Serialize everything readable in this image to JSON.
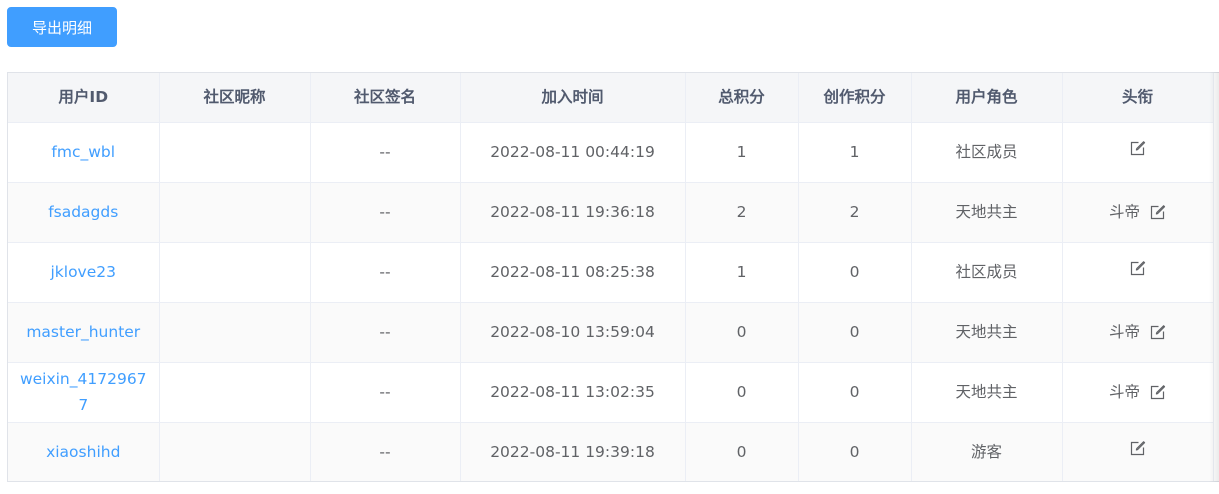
{
  "toolbar": {
    "export_label": "导出明细"
  },
  "table": {
    "columns": [
      "用户ID",
      "社区昵称",
      "社区签名",
      "加入时间",
      "总积分",
      "创作积分",
      "用户角色",
      "头衔"
    ],
    "rows": [
      {
        "uid": "fmc_wbl",
        "nickname": "",
        "signature": "--",
        "join_time": "2022-08-11 00:44:19",
        "total_points": "1",
        "creation_points": "1",
        "role": "社区成员",
        "title": ""
      },
      {
        "uid": "fsadagds",
        "nickname": "",
        "signature": "--",
        "join_time": "2022-08-11 19:36:18",
        "total_points": "2",
        "creation_points": "2",
        "role": "天地共主",
        "title": "斗帝"
      },
      {
        "uid": "jklove23",
        "nickname": "",
        "signature": "--",
        "join_time": "2022-08-11 08:25:38",
        "total_points": "1",
        "creation_points": "0",
        "role": "社区成员",
        "title": ""
      },
      {
        "uid": "master_hunter",
        "nickname": "",
        "signature": "--",
        "join_time": "2022-08-10 13:59:04",
        "total_points": "0",
        "creation_points": "0",
        "role": "天地共主",
        "title": "斗帝"
      },
      {
        "uid": "weixin_41729677",
        "nickname": "",
        "signature": "--",
        "join_time": "2022-08-11 13:02:35",
        "total_points": "0",
        "creation_points": "0",
        "role": "天地共主",
        "title": "斗帝"
      },
      {
        "uid": "xiaoshihd",
        "nickname": "",
        "signature": "--",
        "join_time": "2022-08-11 19:39:18",
        "total_points": "0",
        "creation_points": "0",
        "role": "游客",
        "title": ""
      }
    ]
  },
  "icons": {
    "edit": "edit-icon"
  },
  "colors": {
    "primary": "#409eff",
    "header_bg": "#f5f6f8",
    "stripe_bg": "#fafafa",
    "border": "#ebeef5",
    "text": "#606266"
  }
}
